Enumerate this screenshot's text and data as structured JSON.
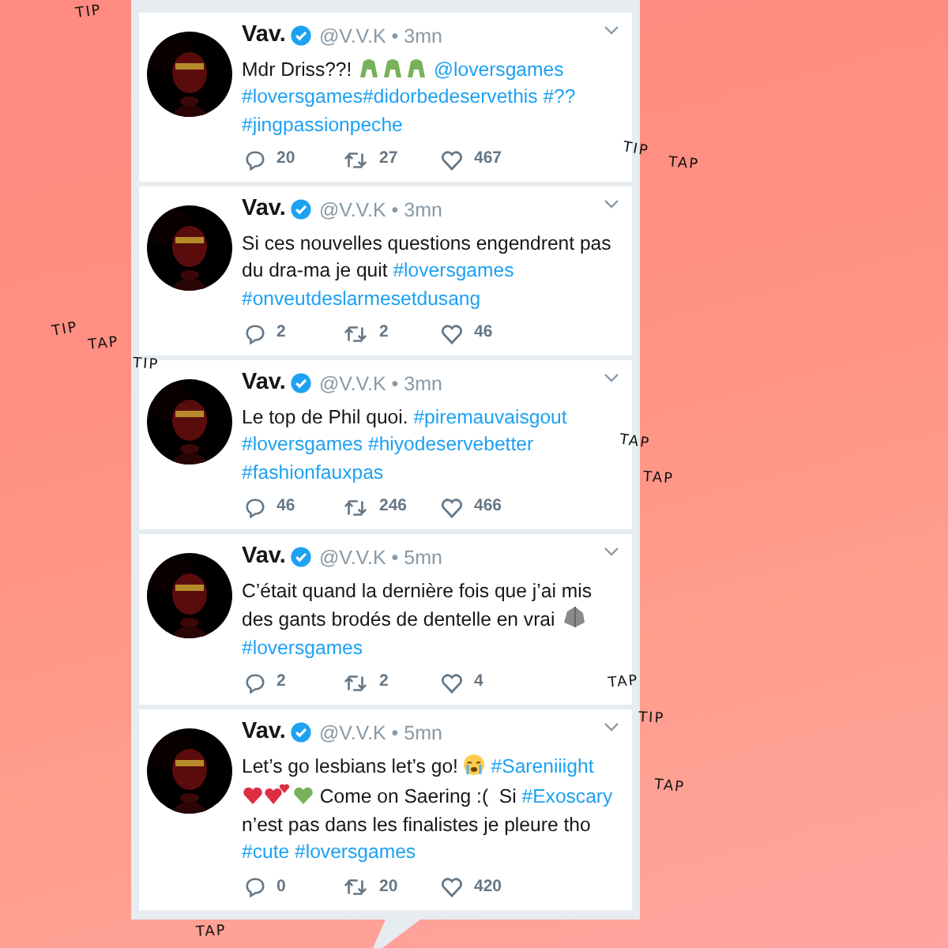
{
  "tweets": [
    {
      "name": "Vav.",
      "verified": true,
      "meta": "@V.V.K • 3mn",
      "body": [
        {
          "kind": "text",
          "text": "Mdr Driss??!"
        },
        {
          "kind": "greenface"
        },
        {
          "kind": "greenface"
        },
        {
          "kind": "greenface"
        },
        {
          "kind": "link",
          "text": "@loversgames"
        },
        {
          "kind": "link",
          "text": "#loversgames#didorbedeservethis"
        },
        {
          "kind": "link",
          "text": "#??"
        },
        {
          "kind": "link",
          "text": "#jingpassionpeche"
        }
      ],
      "replies": "20",
      "retweets": "27",
      "likes": "467"
    },
    {
      "name": "Vav.",
      "verified": true,
      "meta": "@V.V.K • 3mn",
      "body": [
        {
          "kind": "text",
          "text": "Si ces nouvelles questions engendrent pas du dra-ma je quit"
        },
        {
          "kind": "link",
          "text": "#loversgames"
        },
        {
          "kind": "link",
          "text": "#onveutdeslarmesetdusang"
        }
      ],
      "replies": "2",
      "retweets": "2",
      "likes": "46"
    },
    {
      "name": "Vav.",
      "verified": true,
      "meta": "@V.V.K • 3mn",
      "body": [
        {
          "kind": "text",
          "text": "Le top de Phil quoi."
        },
        {
          "kind": "link",
          "text": "#piremauvaisgout"
        },
        {
          "kind": "link",
          "text": "#loversgames"
        },
        {
          "kind": "link",
          "text": "#hiyodeservebetter"
        },
        {
          "kind": "link",
          "text": "#fashionfauxpas"
        }
      ],
      "replies": "46",
      "retweets": "246",
      "likes": "466"
    },
    {
      "name": "Vav.",
      "verified": true,
      "meta": "@V.V.K • 5mn",
      "body": [
        {
          "kind": "text",
          "text": "C’était quand la dernière fois que j’ai mis des gants brodés de dentelle en vrai"
        },
        {
          "kind": "rock"
        },
        {
          "kind": "link",
          "text": "#loversgames"
        }
      ],
      "replies": "2",
      "retweets": "2",
      "likes": "4"
    },
    {
      "name": "Vav.",
      "verified": true,
      "meta": "@V.V.K • 5mn",
      "body": [
        {
          "kind": "text",
          "text": "Let’s go lesbians let’s go!"
        },
        {
          "kind": "crying"
        },
        {
          "kind": "link",
          "text": "#Sareniiight"
        },
        {
          "kind": "redheart"
        },
        {
          "kind": "twohearts"
        },
        {
          "kind": "greenheart"
        },
        {
          "kind": "text",
          "text": "Come on Saering :(  Si"
        },
        {
          "kind": "link",
          "text": "#Exoscary"
        },
        {
          "kind": "text",
          "text": "n’est pas dans les finalistes je pleure tho"
        },
        {
          "kind": "link",
          "text": "#cute"
        },
        {
          "kind": "link",
          "text": "#loversgames"
        }
      ],
      "replies": "0",
      "retweets": "20",
      "likes": "420"
    }
  ],
  "doodles": [
    {
      "text": "TIP"
    },
    {
      "text": "TIP"
    },
    {
      "text": "TAP"
    },
    {
      "text": "TIP"
    },
    {
      "text": "TAP"
    },
    {
      "text": "TIP"
    },
    {
      "text": "TAP"
    },
    {
      "text": "TAP"
    },
    {
      "text": "TAP"
    },
    {
      "text": "TIP"
    },
    {
      "text": "TAP"
    },
    {
      "text": "TAP"
    }
  ]
}
